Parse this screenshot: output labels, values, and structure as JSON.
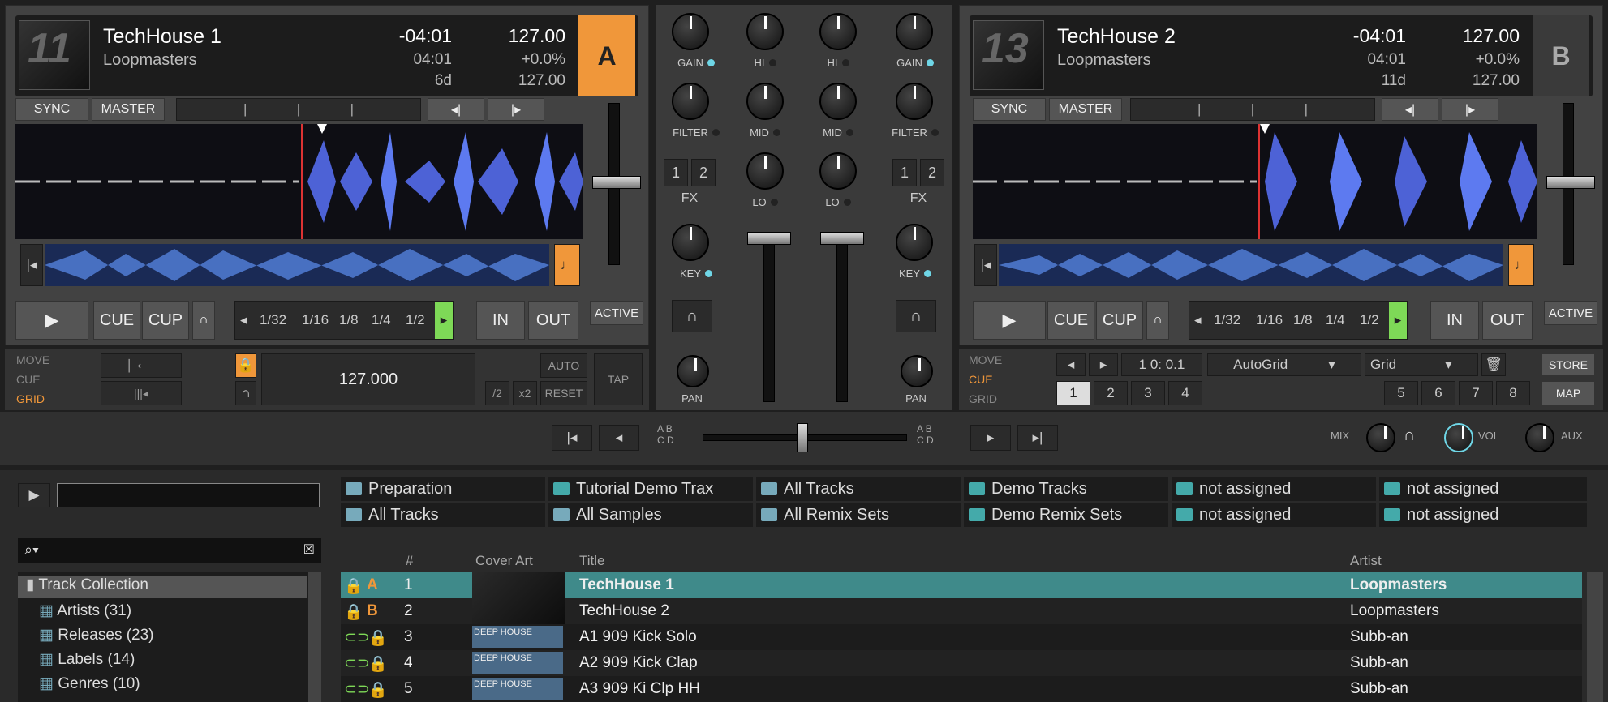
{
  "deck_a": {
    "letter": "A",
    "title": "TechHouse 1",
    "artist": "Loopmasters",
    "remaining": "-04:01",
    "bpm": "127.00",
    "elapsed": "04:01",
    "pitch": "+0.0%",
    "key": "6d",
    "tempo": "127.00",
    "sync": "SYNC",
    "master": "MASTER",
    "cue": "CUE",
    "cup": "CUP",
    "loops": [
      "1/32",
      "1/16",
      "1/8",
      "1/4",
      "1/2"
    ],
    "in": "IN",
    "out": "OUT",
    "active": "ACTIVE",
    "mode": [
      "MOVE",
      "CUE",
      "GRID"
    ],
    "grid_bpm": "127.000",
    "auto": "AUTO",
    "tap": "TAP",
    "reset": "RESET",
    "half": "/2",
    "double": "x2",
    "cover_num": "11"
  },
  "deck_b": {
    "letter": "B",
    "title": "TechHouse 2",
    "artist": "Loopmasters",
    "remaining": "-04:01",
    "bpm": "127.00",
    "elapsed": "04:01",
    "pitch": "+0.0%",
    "key": "11d",
    "tempo": "127.00",
    "sync": "SYNC",
    "master": "MASTER",
    "cue": "CUE",
    "cup": "CUP",
    "loops": [
      "1/32",
      "1/16",
      "1/8",
      "1/4",
      "1/2"
    ],
    "in": "IN",
    "out": "OUT",
    "active": "ACTIVE",
    "mode": [
      "MOVE",
      "CUE",
      "GRID"
    ],
    "position": "1 0: 0.1",
    "autogrid": "AutoGrid",
    "grid": "Grid",
    "store": "STORE",
    "map": "MAP",
    "hotcues": [
      "1",
      "2",
      "3",
      "4",
      "5",
      "6",
      "7",
      "8"
    ],
    "cover_num": "13"
  },
  "mixer": {
    "gain": "GAIN",
    "hi": "HI",
    "mid": "MID",
    "lo": "LO",
    "filter": "FILTER",
    "fx": "FX",
    "fx1": "1",
    "fx2": "2",
    "key": "KEY",
    "pan": "PAN",
    "xfader_labels": [
      "A",
      "B",
      "C",
      "D"
    ],
    "mix": "MIX",
    "vol": "VOL",
    "aux": "AUX"
  },
  "browser": {
    "favorites": [
      [
        "Preparation",
        "All Tracks"
      ],
      [
        "Tutorial Demo Trax",
        "All Samples"
      ],
      [
        "All Tracks",
        "All Remix Sets"
      ],
      [
        "Demo Tracks",
        "Demo Remix Sets"
      ],
      [
        "not assigned",
        "not assigned"
      ],
      [
        "not assigned",
        "not assigned"
      ]
    ],
    "tree": [
      "Track Collection",
      "Artists (31)",
      "Releases (23)",
      "Labels (14)",
      "Genres (10)"
    ],
    "columns": {
      "num": "#",
      "cover": "Cover Art",
      "title": "Title",
      "artist": "Artist"
    },
    "rows": [
      {
        "deck": "A",
        "num": "1",
        "title": "TechHouse 1",
        "artist": "Loopmasters"
      },
      {
        "deck": "B",
        "num": "2",
        "title": "TechHouse 2",
        "artist": "Loopmasters"
      },
      {
        "deck": "",
        "num": "3",
        "title": "A1 909 Kick Solo",
        "artist": "Subb-an",
        "cover": "DEEP HOUSE"
      },
      {
        "deck": "",
        "num": "4",
        "title": "A2 909 Kick Clap",
        "artist": "Subb-an",
        "cover": "DEEP HOUSE"
      },
      {
        "deck": "",
        "num": "5",
        "title": "A3 909 Ki Clp HH",
        "artist": "Subb-an",
        "cover": "DEEP HOUSE"
      }
    ]
  },
  "colors": {
    "deck_a": "#f0973a",
    "accent_green": "#7ed957",
    "selected_row": "#3f8a8a",
    "cyan": "#6fd6e6"
  }
}
